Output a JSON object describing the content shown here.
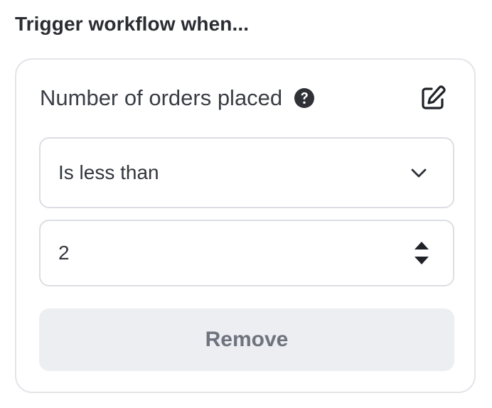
{
  "section_title": "Trigger workflow when...",
  "condition": {
    "title": "Number of orders placed",
    "help_icon": "question-circle-icon",
    "edit_icon": "edit-square-icon",
    "operator": {
      "selected": "Is less than",
      "icon": "chevron-down-icon"
    },
    "value": {
      "current": "2",
      "icon": "up-down-stepper-icon"
    },
    "remove_label": "Remove"
  },
  "colors": {
    "border": "#e3e5e9",
    "field_border": "#dcdee3",
    "button_bg": "#eceef2",
    "button_text": "#6e737d",
    "text": "#3a3d44"
  }
}
